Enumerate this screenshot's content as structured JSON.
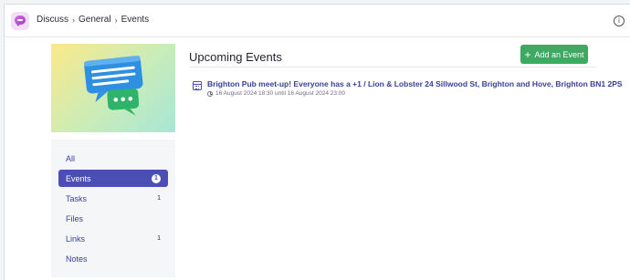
{
  "breadcrumb": {
    "items": [
      "Discuss",
      "General",
      "Events"
    ],
    "separator": "›"
  },
  "icons": {
    "logo": "chat-bubble-logo-icon",
    "info": "info-icon",
    "illustration": "chat-bubbles-illustration",
    "calendar": "calendar-icon",
    "clock": "clock-icon"
  },
  "sidebar": {
    "items": [
      {
        "label": "All",
        "count": ""
      },
      {
        "label": "Events",
        "count": "1"
      },
      {
        "label": "Tasks",
        "count": "1"
      },
      {
        "label": "Files",
        "count": ""
      },
      {
        "label": "Links",
        "count": "1"
      },
      {
        "label": "Notes",
        "count": ""
      }
    ],
    "active_index": 1
  },
  "main": {
    "title": "Upcoming Events",
    "add_button_label": "Add an Event",
    "add_button_plus": "+",
    "events": [
      {
        "title": "Brighton Pub meet-up! Everyone has a +1 / Lion & Lobster 24 Sillwood St, Brighton and Hove, Brighton BN1 2PS",
        "time": "16 August 2024 18:30 until 16 August 2024 23:00"
      }
    ]
  },
  "colors": {
    "accent": "#4b4fb4",
    "primary_button": "#3fa863",
    "link_text": "#3a3f9a"
  }
}
